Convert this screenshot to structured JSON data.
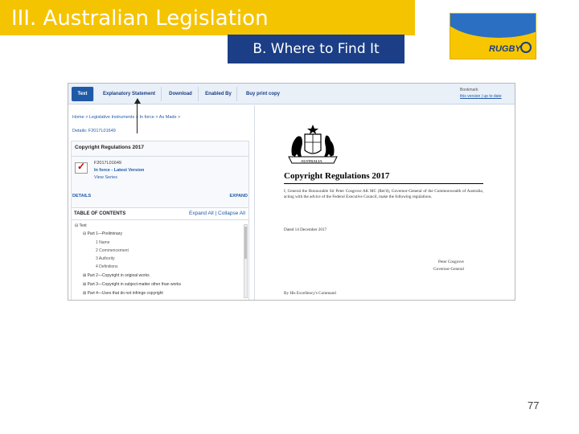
{
  "slide": {
    "title": "III. Australian Legislation",
    "subtitle": "B. Where to Find It",
    "logo_text": "RUGBY",
    "page_number": "77"
  },
  "screenshot": {
    "tabs": [
      "Text",
      "Explanatory Statement",
      "Download",
      "Enabled By",
      "Buy print copy"
    ],
    "active_tab": "Text",
    "bookmark": {
      "label": "Bookmark",
      "links": "this version | up to date"
    },
    "breadcrumb": [
      "Home",
      "Legislative Instruments",
      "In force",
      "As Made"
    ],
    "details_id": "Details: F2017L01649",
    "card": {
      "title": "Copyright Regulations 2017",
      "id": "F2017L01649",
      "status": "In force - Latest Version",
      "view_series": "View Series"
    },
    "details_bar": {
      "label": "DETAILS",
      "action": "EXPAND"
    },
    "toc": {
      "heading": "TABLE OF CONTENTS",
      "expand_all": "Expand All",
      "collapse_all": "Collapse All",
      "items": [
        {
          "text": "Text",
          "level": 0
        },
        {
          "text": "Part 1—Preliminary",
          "level": 1
        },
        {
          "text": "1 Name",
          "level": 2
        },
        {
          "text": "2 Commencement",
          "level": 2
        },
        {
          "text": "3 Authority",
          "level": 2
        },
        {
          "text": "4 Definitions",
          "level": 2
        },
        {
          "text": "Part 2—Copyright in original works",
          "level": 1
        },
        {
          "text": "Part 3—Copyright in subject-matter other than works",
          "level": 1
        },
        {
          "text": "Part 4—Uses that do not infringe copyright",
          "level": 1
        }
      ]
    },
    "document": {
      "crest_banner": "AUSTRALIA",
      "title": "Copyright Regulations 2017",
      "body": "I, General the Honourable Sir Peter Cosgrove AK MC (Ret'd), Governor-General of the Commonwealth of Australia, acting with the advice of the Federal Executive Council, make the following regulations.",
      "dated": "Dated 14 December 2017",
      "signer": "Peter Cosgrove",
      "signer_title": "Governor-General",
      "command": "By His Excellency's Command"
    }
  },
  "colors": {
    "title_bar": "#f5c400",
    "subtitle_bar": "#1b3e86",
    "link_blue": "#1f5aa8",
    "tab_active": "#1f5aa8"
  }
}
